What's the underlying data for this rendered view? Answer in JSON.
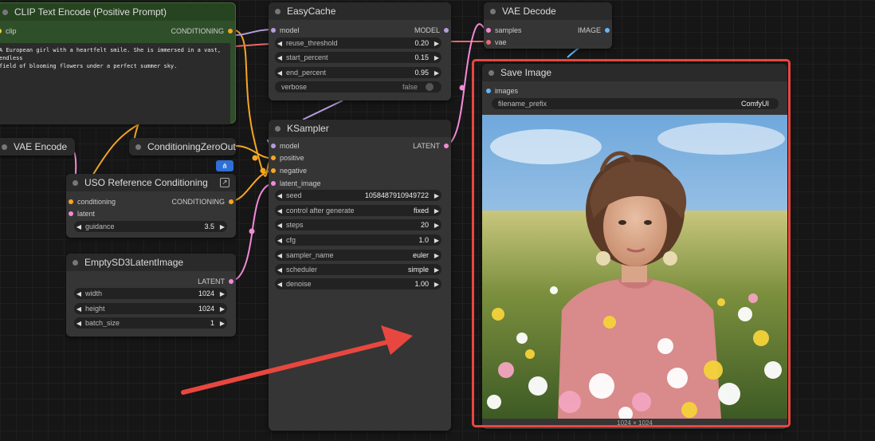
{
  "nodes": {
    "clip_text_encode": {
      "title": "CLIP Text Encode (Positive Prompt)",
      "input_clip": "clip",
      "output": "CONDITIONING",
      "prompt_line1": "A European girl with a heartfelt smile. She is immersed in a vast, endless",
      "prompt_line2": "field of blooming flowers under a perfect summer sky."
    },
    "easycache": {
      "title": "EasyCache",
      "input_model": "model",
      "output": "MODEL",
      "widgets": [
        {
          "label": "reuse_threshold",
          "value": "0.20"
        },
        {
          "label": "start_percent",
          "value": "0.15"
        },
        {
          "label": "end_percent",
          "value": "0.95"
        },
        {
          "label": "verbose",
          "value": "false"
        }
      ]
    },
    "vae_decode": {
      "title": "VAE Decode",
      "input_samples": "samples",
      "input_vae": "vae",
      "output": "IMAGE"
    },
    "save_image": {
      "title": "Save Image",
      "input_images": "images",
      "filename_label": "filename_prefix",
      "filename_value": "ComfyUI",
      "image_size": "1024 × 1024"
    },
    "vae_encode": {
      "title": "VAE Encode"
    },
    "conditioning_zero_out": {
      "title": "ConditioningZeroOut"
    },
    "uso_reference": {
      "title": "USO Reference Conditioning",
      "input_conditioning": "conditioning",
      "input_latent": "latent",
      "output": "CONDITIONING",
      "guidance_label": "guidance",
      "guidance_value": "3.5"
    },
    "empty_latent": {
      "title": "EmptySD3LatentImage",
      "output": "LATENT",
      "widgets": [
        {
          "label": "width",
          "value": "1024"
        },
        {
          "label": "height",
          "value": "1024"
        },
        {
          "label": "batch_size",
          "value": "1"
        }
      ]
    },
    "ksampler": {
      "title": "KSampler",
      "input_model": "model",
      "input_positive": "positive",
      "input_negative": "negative",
      "input_latent": "latent_image",
      "output": "LATENT",
      "widgets": [
        {
          "label": "seed",
          "value": "1058487910949722"
        },
        {
          "label": "control after generate",
          "value": "fixed"
        },
        {
          "label": "steps",
          "value": "20"
        },
        {
          "label": "cfg",
          "value": "1.0"
        },
        {
          "label": "sampler_name",
          "value": "euler"
        },
        {
          "label": "scheduler",
          "value": "simple"
        },
        {
          "label": "denoise",
          "value": "1.00"
        }
      ]
    }
  },
  "colors": {
    "accent_red": "#e8473f",
    "wire_purple": "#b39ddb",
    "wire_orange": "#f5a623",
    "wire_pink": "#f28ad6",
    "wire_red": "#e86a6a",
    "wire_blue": "#64b5f6",
    "clip_node_green": "#2f4f2a"
  },
  "icons": {
    "node_badge": "hierarchy-icon",
    "expand": "expand-icon",
    "arrow": "annotation-arrow"
  }
}
